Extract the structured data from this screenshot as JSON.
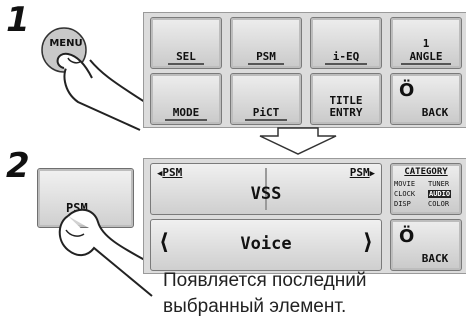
{
  "steps": {
    "first": "1",
    "second": "2"
  },
  "menu_button": {
    "label": "MENU"
  },
  "menu_panel": {
    "row1": [
      "SEL",
      "PSM",
      "i-EQ"
    ],
    "angle_number": "1",
    "angle_label": "ANGLE",
    "row2": [
      "MODE",
      "PiCT"
    ],
    "title_entry_line1": "TITLE",
    "title_entry_line2": "ENTRY",
    "back_label": "BACK"
  },
  "psm_button": {
    "label": "PSM"
  },
  "psm_panel": {
    "left_label": "PSM",
    "right_label": "PSM",
    "setting_name": "VSS",
    "value": "Voice",
    "category_title": "CATEGORY",
    "category_items": [
      "MOVIE",
      "TUNER",
      "CLOCK",
      "AUDIO",
      "DISP",
      "COLOR"
    ],
    "back_label": "BACK"
  },
  "caption": {
    "line1": "Появляется последний",
    "line2": "выбранный элемент."
  },
  "colors": {
    "panel": "#dcdcdc",
    "key": "#e6e6e6",
    "arrow": "#333333"
  }
}
